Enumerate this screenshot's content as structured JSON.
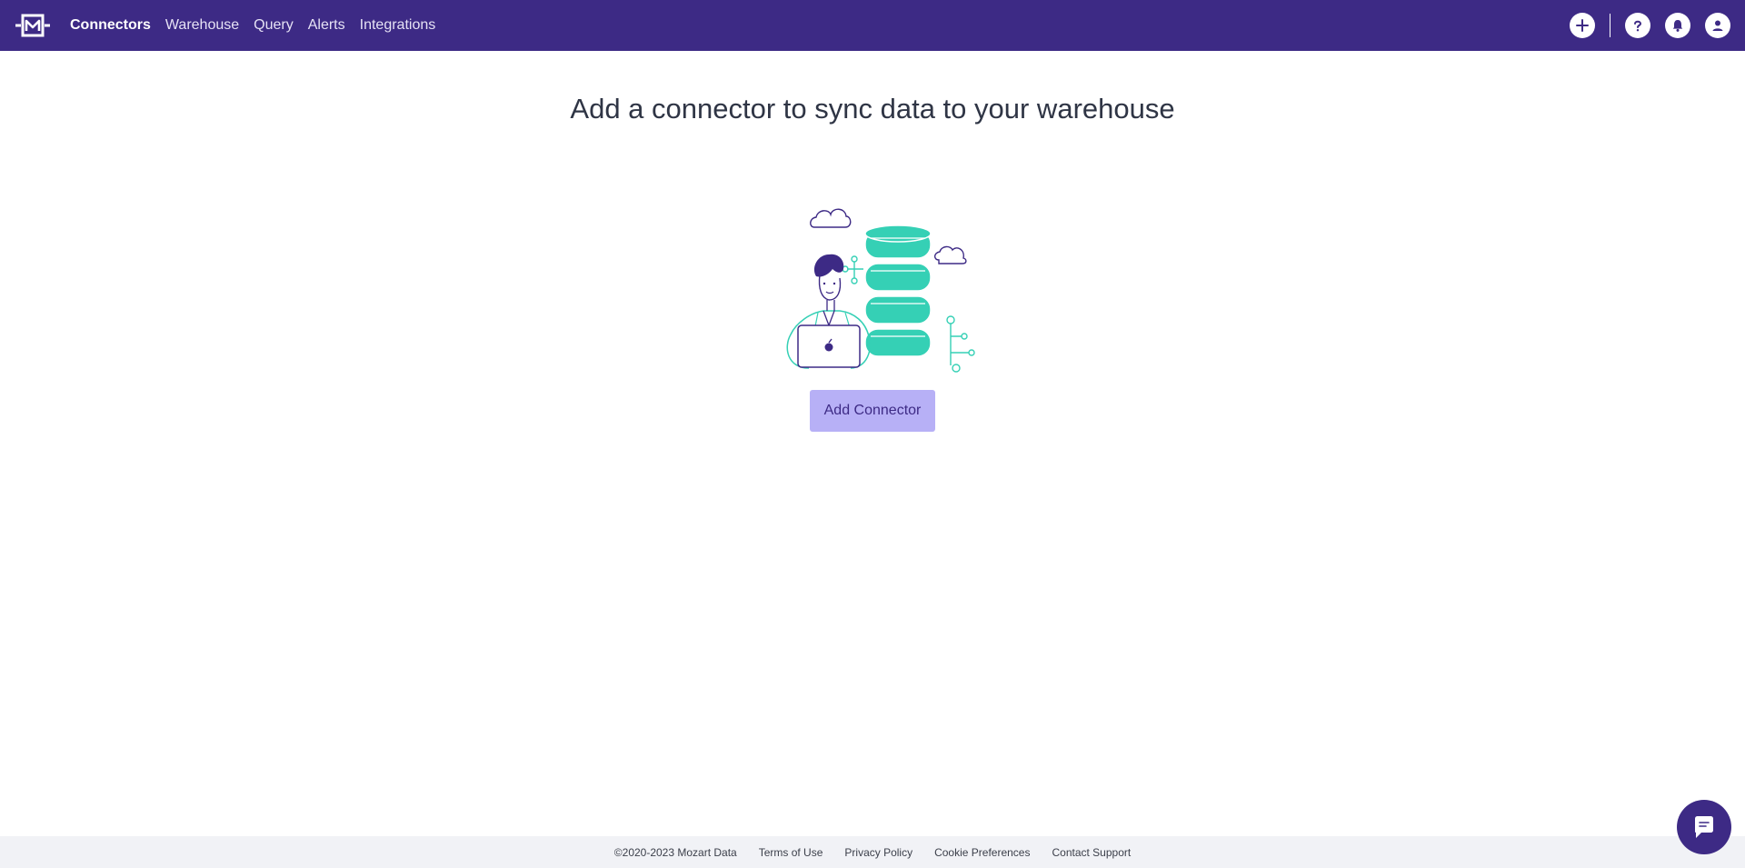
{
  "app": {
    "brand_color": "#3d2a85",
    "accent_color": "#b7b0f6",
    "illustration_color": "#35d0b5"
  },
  "nav": {
    "logo_icon": "mozart-logo-icon",
    "links": [
      {
        "label": "Connectors",
        "active": true
      },
      {
        "label": "Warehouse",
        "active": false
      },
      {
        "label": "Query",
        "active": false
      },
      {
        "label": "Alerts",
        "active": false
      },
      {
        "label": "Integrations",
        "active": false
      }
    ],
    "right_icons": [
      "plus-icon",
      "help-icon",
      "bell-icon",
      "user-icon"
    ]
  },
  "main": {
    "title": "Add a connector to sync data to your warehouse",
    "illustration_icon": "person-database-illustration",
    "button_label": "Add Connector"
  },
  "footer": {
    "copyright": "©2020-2023 Mozart Data",
    "links": [
      "Terms of Use",
      "Privacy Policy",
      "Cookie Preferences",
      "Contact Support"
    ]
  },
  "chat": {
    "icon": "chat-icon"
  }
}
